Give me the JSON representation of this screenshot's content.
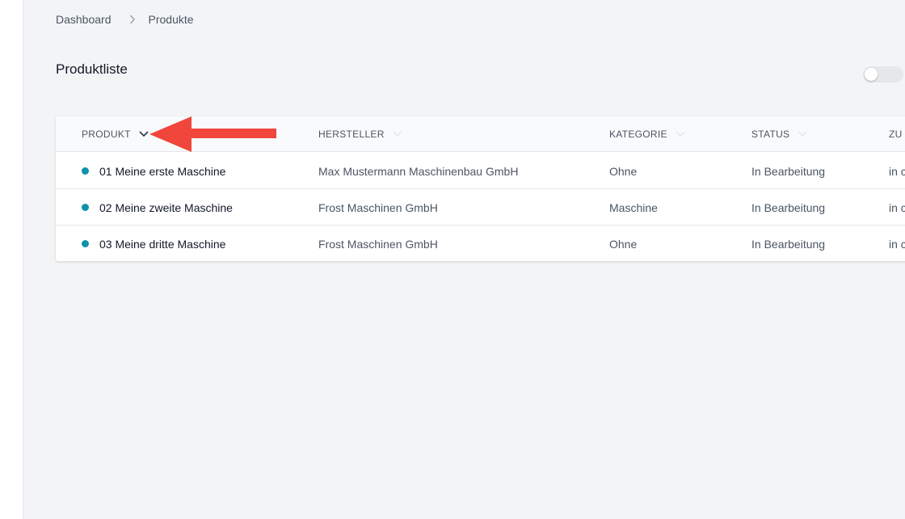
{
  "colors": {
    "status_dot": "#0e91a9",
    "annotation": "#f0463c",
    "page_bg": "#f3f4f6"
  },
  "breadcrumb": {
    "items": [
      "Dashboard",
      "Produkte"
    ],
    "separator_icon": "chevron-right-icon"
  },
  "page": {
    "title": "Produktliste"
  },
  "toggle": {
    "on": false
  },
  "table": {
    "columns": [
      {
        "label": "PRODUKT",
        "sort_icon": "chevron-down-icon",
        "active": true
      },
      {
        "label": "HERSTELLER",
        "sort_icon": "chevron-down-icon",
        "active": false
      },
      {
        "label": "KATEGORIE",
        "sort_icon": "chevron-down-icon",
        "active": false
      },
      {
        "label": "STATUS",
        "sort_icon": "chevron-down-icon",
        "active": false
      },
      {
        "label": "ZU",
        "sort_icon": "chevron-down-icon",
        "active": false
      }
    ],
    "rows": [
      {
        "name": "01 Meine erste Maschine",
        "manufacturer": "Max Mustermann Maschinenbau GmbH",
        "category": "Ohne",
        "status": "In Bearbeitung",
        "assigned": "in c"
      },
      {
        "name": "02 Meine zweite Maschine",
        "manufacturer": "Frost Maschinen GmbH",
        "category": "Maschine",
        "status": "In Bearbeitung",
        "assigned": "in c"
      },
      {
        "name": "03 Meine dritte Maschine",
        "manufacturer": "Frost Maschinen GmbH",
        "category": "Ohne",
        "status": "In Bearbeitung",
        "assigned": "in c"
      }
    ]
  }
}
